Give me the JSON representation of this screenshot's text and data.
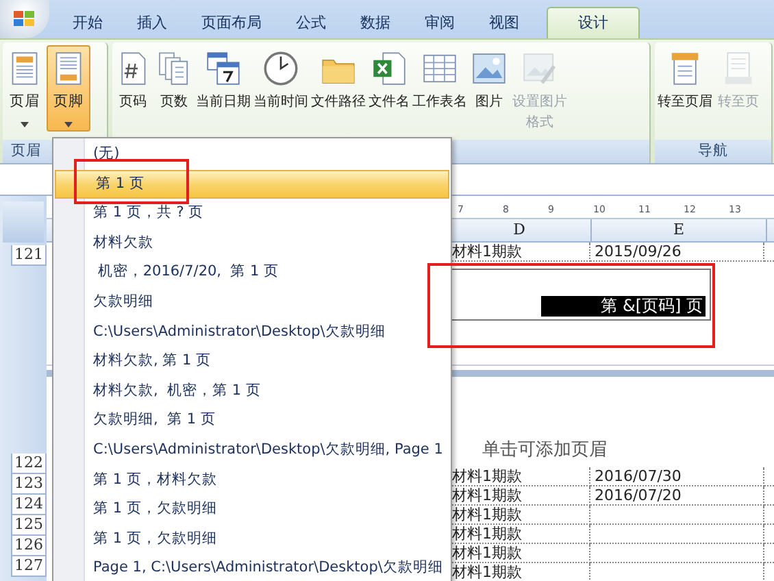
{
  "tabs": [
    {
      "label": "开始",
      "selected": false
    },
    {
      "label": "插入",
      "selected": false
    },
    {
      "label": "页面布局",
      "selected": false
    },
    {
      "label": "公式",
      "selected": false
    },
    {
      "label": "数据",
      "selected": false
    },
    {
      "label": "审阅",
      "selected": false
    },
    {
      "label": "视图",
      "selected": false
    },
    {
      "label": "设计",
      "selected": true
    }
  ],
  "ribbon": {
    "groups": [
      {
        "label": "页眉",
        "buttons": [
          {
            "label": "页眉",
            "dropdown": true,
            "pressed": false,
            "disabled": false
          },
          {
            "label": "页脚",
            "dropdown": true,
            "pressed": true,
            "disabled": false
          }
        ]
      },
      {
        "buttons": [
          {
            "label": "页码",
            "dropdown": false,
            "pressed": false,
            "disabled": false
          },
          {
            "label": "页数",
            "dropdown": false,
            "pressed": false,
            "disabled": false
          },
          {
            "label": "当前日期",
            "dropdown": false,
            "pressed": false,
            "disabled": false
          },
          {
            "label": "当前时间",
            "dropdown": false,
            "pressed": false,
            "disabled": false
          },
          {
            "label": "文件路径",
            "dropdown": false,
            "pressed": false,
            "disabled": false
          },
          {
            "label": "文件名",
            "dropdown": false,
            "pressed": false,
            "disabled": false
          },
          {
            "label": "工作表名",
            "dropdown": false,
            "pressed": false,
            "disabled": false
          },
          {
            "label": "图片",
            "dropdown": false,
            "pressed": false,
            "disabled": false
          },
          {
            "label": "设置图片格式",
            "dropdown": false,
            "pressed": false,
            "disabled": true
          }
        ]
      },
      {
        "label": "导航",
        "buttons": [
          {
            "label": "转至页眉",
            "dropdown": false,
            "pressed": false,
            "disabled": false
          },
          {
            "label": "转至页",
            "dropdown": false,
            "pressed": false,
            "disabled": true
          }
        ]
      }
    ]
  },
  "footer_menu": {
    "items": [
      {
        "label": "(无)",
        "selected": false
      },
      {
        "label": "第 1 页",
        "selected": true
      },
      {
        "label": "第 1 页，共 ? 页",
        "selected": false
      },
      {
        "label": "材料欠款",
        "selected": false
      },
      {
        "label": " 机密，2016/7/20,  第 1 页",
        "selected": false
      },
      {
        "label": "欠款明细",
        "selected": false
      },
      {
        "label": "C:\\Users\\Administrator\\Desktop\\欠款明细",
        "selected": false
      },
      {
        "label": "材料欠款, 第 1 页",
        "selected": false
      },
      {
        "label": "材料欠款,  机密，第 1 页",
        "selected": false
      },
      {
        "label": "欠款明细,  第 1 页",
        "selected": false
      },
      {
        "label": "C:\\Users\\Administrator\\Desktop\\欠款明细, Page 1",
        "selected": false
      },
      {
        "label": "第 1 页，材料欠款",
        "selected": false
      },
      {
        "label": "第 1 页，欠款明细",
        "selected": false
      },
      {
        "label": "第 1 页，欠款明细",
        "selected": false
      },
      {
        "label": "Page 1, C:\\Users\\Administrator\\Desktop\\欠款明细",
        "selected": false
      }
    ]
  },
  "sheet": {
    "ruler": [
      "7",
      "8",
      "9",
      "10",
      "11",
      "12",
      "13"
    ],
    "columns": [
      "D",
      "E"
    ],
    "top_rows": [
      {
        "number": "121",
        "cells": [
          "材料1期款",
          "2015/09/26"
        ]
      }
    ],
    "footer_text": "第 &[页码] 页",
    "header_hint": "单击可添加页眉",
    "rows": [
      {
        "number": "122",
        "cells": [
          "材料1期款",
          "2016/07/30"
        ]
      },
      {
        "number": "123",
        "cells": [
          "材料1期款",
          "2016/07/20"
        ]
      },
      {
        "number": "124",
        "cells": [
          "材料1期款"
        ]
      },
      {
        "number": "125",
        "cells": [
          "材料1期款"
        ]
      },
      {
        "number": "126",
        "cells": [
          "材料1期款"
        ]
      },
      {
        "number": "127",
        "cells": [
          "材料1期款"
        ]
      }
    ]
  }
}
